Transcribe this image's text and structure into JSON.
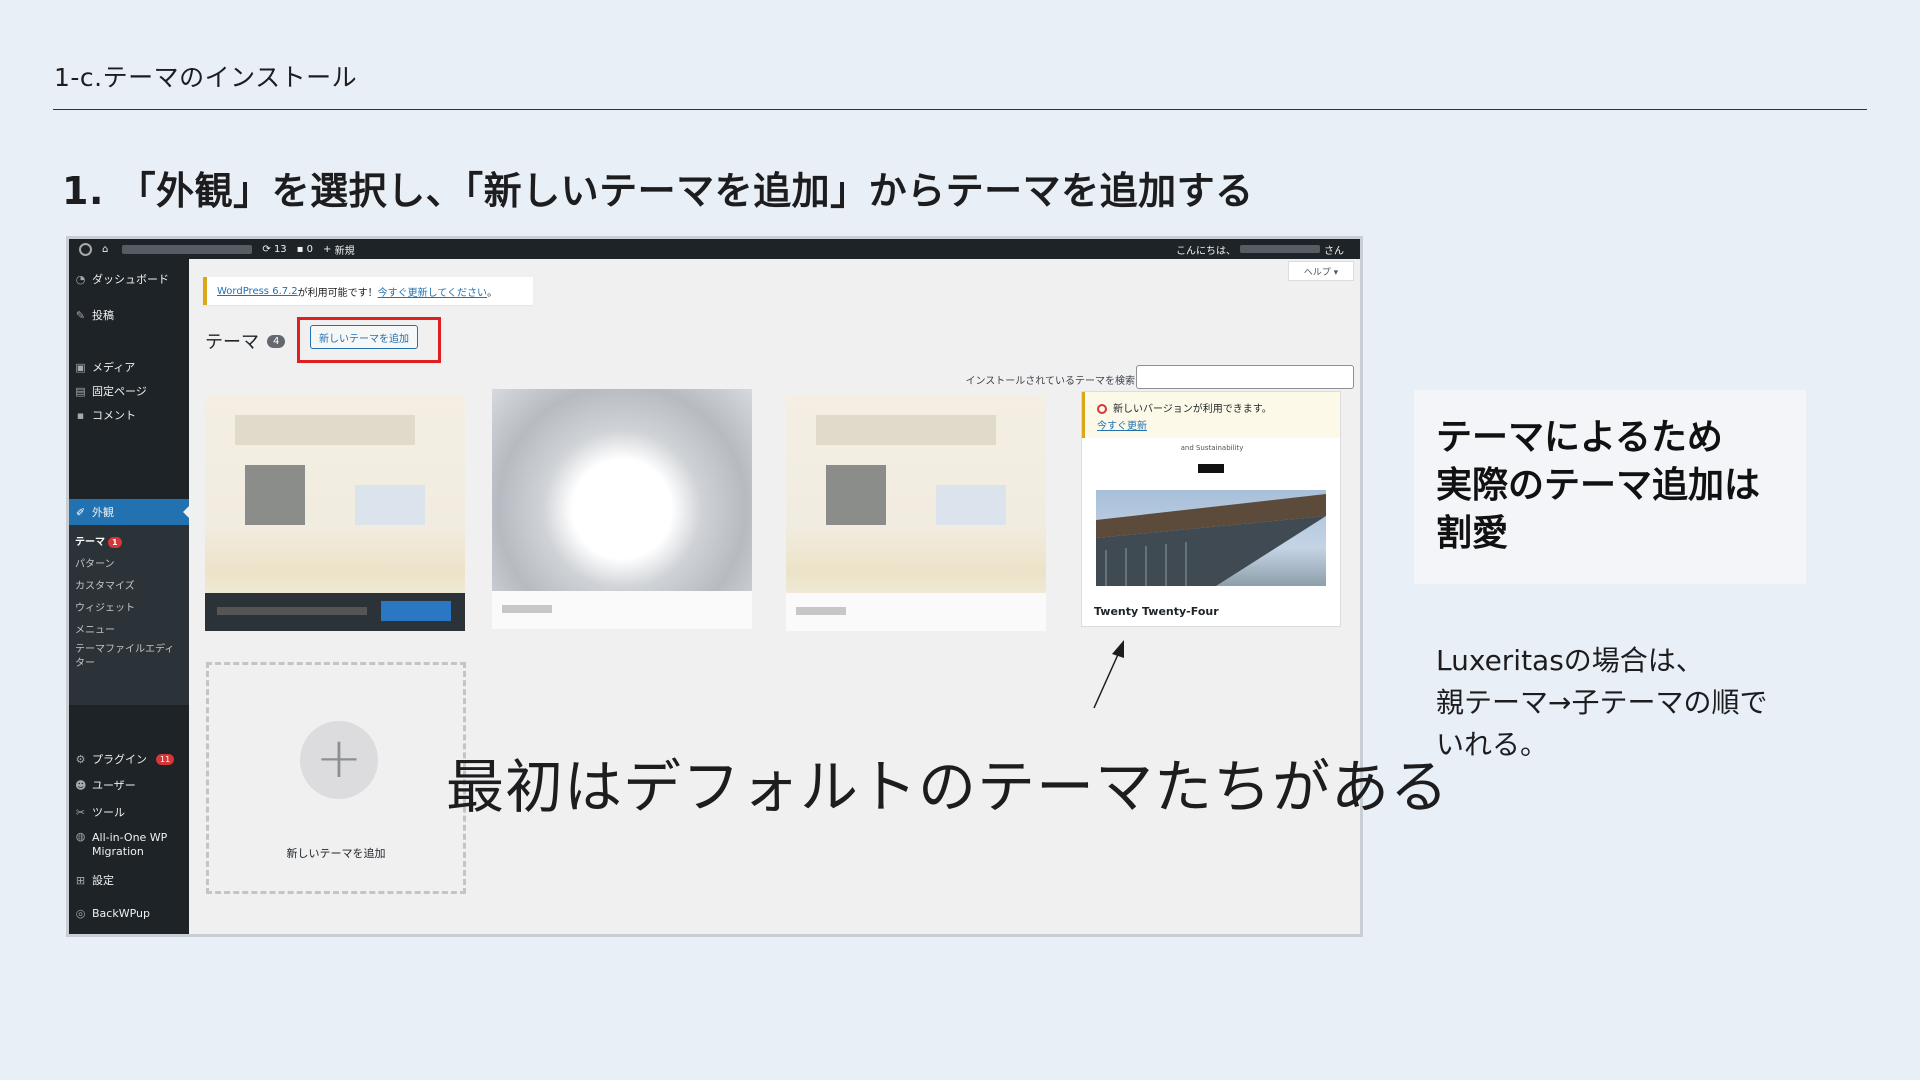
{
  "slide": {
    "section_title": "1-c.テーマのインストール",
    "heading": "1. 「外観」を選択し、「新しいテーマを追加」からテーマを追加する",
    "caption": "最初はデフォルトのテーマたちがある",
    "side_box": "テーマによるため\n実際のテーマ追加は\n割愛",
    "side_note": "Luxeritasの場合は、\n親テーマ→子テーマの順で\nいれる。",
    "highlight_color": "#e02020"
  },
  "adminbar": {
    "updates": "13",
    "comments": "0",
    "new_label": "新規",
    "greeting": "こんにちは、",
    "suffix": "さん"
  },
  "sidebar": {
    "items": [
      {
        "label": "ダッシュボード",
        "icon": "dashboard-icon"
      },
      {
        "label": "投稿",
        "icon": "pin-icon"
      },
      {
        "label": "メディア",
        "icon": "media-icon"
      },
      {
        "label": "固定ページ",
        "icon": "page-icon"
      },
      {
        "label": "コメント",
        "icon": "comment-icon"
      },
      {
        "label": "外観",
        "icon": "brush-icon"
      },
      {
        "label": "プラグイン",
        "icon": "plugin-icon",
        "badge": "11"
      },
      {
        "label": "ユーザー",
        "icon": "user-icon"
      },
      {
        "label": "ツール",
        "icon": "wrench-icon"
      },
      {
        "label": "All-in-One WP Migration",
        "icon": "migration-icon"
      },
      {
        "label": "設定",
        "icon": "settings-icon"
      },
      {
        "label": "BackWPup",
        "icon": "backwpup-icon"
      }
    ],
    "submenu": [
      {
        "label": "テーマ",
        "badge": "1"
      },
      {
        "label": "パターン"
      },
      {
        "label": "カスタマイズ"
      },
      {
        "label": "ウィジェット"
      },
      {
        "label": "メニュー"
      },
      {
        "label": "テーマファイルエディター"
      }
    ]
  },
  "content": {
    "help": "ヘルプ ▾",
    "notice_link1": "WordPress 6.7.2",
    "notice_mid": " が利用可能です！",
    "notice_link2": "今すぐ更新してください",
    "notice_end": "。",
    "themes_title": "テーマ",
    "themes_count": "4",
    "add_button": "新しいテーマを追加",
    "search_label": "インストールされているテーマを検索",
    "update_notice": "新しいバージョンが利用できます。",
    "update_link": "今すぐ更新",
    "tt4_heading": "and Sustainability",
    "tt4_name": "Twenty Twenty-Four",
    "add_card_label": "新しいテーマを追加"
  }
}
